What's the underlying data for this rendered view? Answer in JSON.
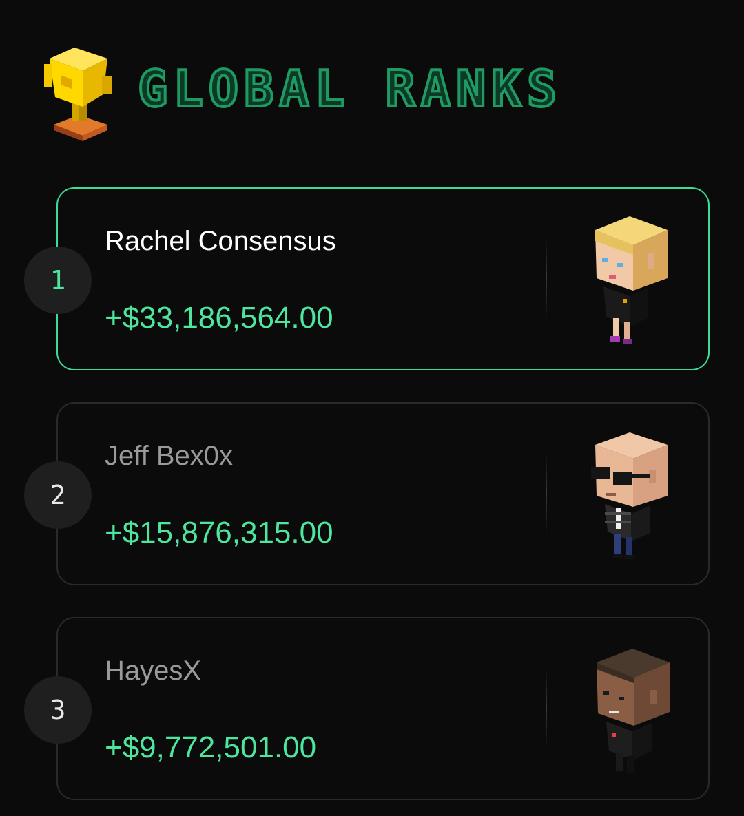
{
  "header": {
    "title": "GLOBAL RANKS",
    "icon": "trophy-icon"
  },
  "colors": {
    "accent": "#4ee69e",
    "top_border": "#3ddc97",
    "title_green": "#1f9a63",
    "background": "#0b0b0b"
  },
  "ranks": [
    {
      "rank": "1",
      "name": "Rachel Consensus",
      "amount": "+$33,186,564.00",
      "avatar": "blonde-woman-avatar"
    },
    {
      "rank": "2",
      "name": "Jeff Bex0x",
      "amount": "+$15,876,315.00",
      "avatar": "bald-man-sunglasses-avatar"
    },
    {
      "rank": "3",
      "name": "HayesX",
      "amount": "+$9,772,501.00",
      "avatar": "dark-haired-man-avatar"
    }
  ]
}
